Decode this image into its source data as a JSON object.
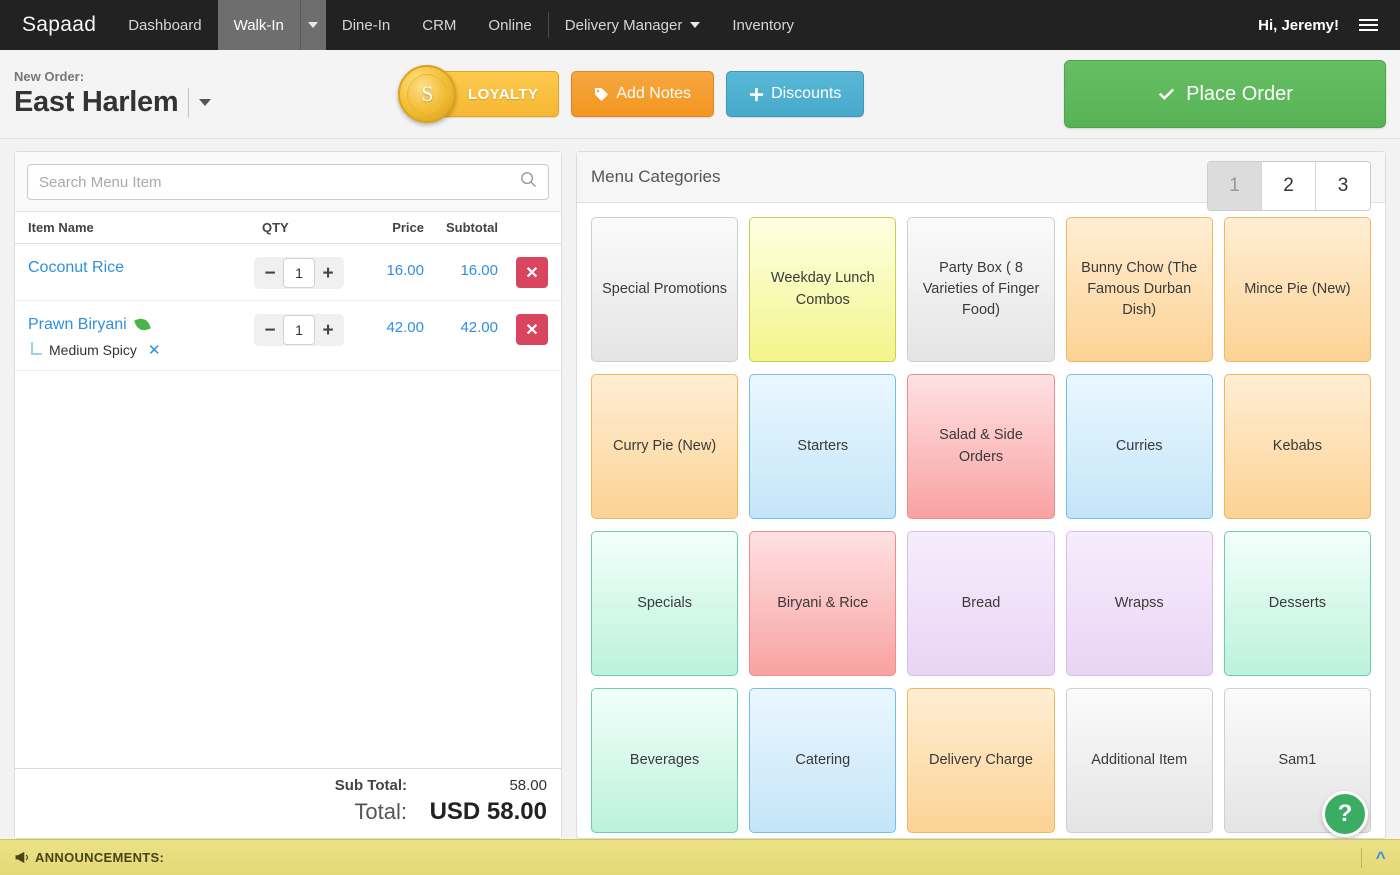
{
  "navbar": {
    "brand": "Sapaad",
    "items": [
      {
        "label": "Dashboard",
        "active": false
      },
      {
        "label": "Walk-In",
        "active": true
      },
      {
        "label": "Dine-In",
        "active": false
      },
      {
        "label": "CRM",
        "active": false
      },
      {
        "label": "Online",
        "active": false
      },
      {
        "label": "Delivery Manager",
        "active": false,
        "caret": true
      },
      {
        "label": "Inventory",
        "active": false
      }
    ],
    "greeting": "Hi, Jeremy!",
    "menu_icon": "hamburger-menu-icon"
  },
  "order_header": {
    "new_order_label": "New Order:",
    "location": "East Harlem",
    "loyalty_label": "LOYALTY",
    "loyalty_coin_letter": "S",
    "add_notes_label": "Add Notes",
    "add_notes_icon": "tag-icon",
    "discounts_label": "Discounts",
    "discounts_icon": "plus-icon",
    "place_order_label": "Place Order",
    "place_order_icon": "check-icon"
  },
  "order_panel": {
    "search_placeholder": "Search Menu Item",
    "search_value": "",
    "search_icon": "search-icon",
    "columns": {
      "name": "Item Name",
      "qty": "QTY",
      "price": "Price",
      "subtotal": "Subtotal"
    },
    "items": [
      {
        "name": "Coconut Rice",
        "vegetarian": false,
        "qty": "1",
        "price": "16.00",
        "subtotal": "16.00",
        "modifiers": []
      },
      {
        "name": "Prawn Biryani",
        "vegetarian": true,
        "qty": "1",
        "price": "42.00",
        "subtotal": "42.00",
        "modifiers": [
          {
            "label": "Medium Spicy"
          }
        ]
      }
    ],
    "totals": {
      "subtotal_label": "Sub Total:",
      "subtotal_value": "58.00",
      "total_label": "Total:",
      "total_value": "USD 58.00"
    }
  },
  "menu_panel": {
    "title": "Menu Categories",
    "pages": [
      {
        "label": "1",
        "active": true
      },
      {
        "label": "2",
        "active": false
      },
      {
        "label": "3",
        "active": false
      }
    ],
    "categories": [
      {
        "label": "Special Promotions",
        "color": "gray"
      },
      {
        "label": "Weekday Lunch Combos",
        "color": "yellow"
      },
      {
        "label": "Party Box ( 8 Varieties of Finger Food)",
        "color": "gray"
      },
      {
        "label": "Bunny Chow (The Famous Durban Dish)",
        "color": "orange"
      },
      {
        "label": "Mince Pie (New)",
        "color": "orange"
      },
      {
        "label": "Curry Pie (New)",
        "color": "orange"
      },
      {
        "label": "Starters",
        "color": "blue"
      },
      {
        "label": "Salad & Side Orders",
        "color": "red"
      },
      {
        "label": "Curries",
        "color": "blue"
      },
      {
        "label": "Kebabs",
        "color": "orange"
      },
      {
        "label": "Specials",
        "color": "mint"
      },
      {
        "label": "Biryani & Rice",
        "color": "red"
      },
      {
        "label": "Bread",
        "color": "purple"
      },
      {
        "label": "Wrapss",
        "color": "purple"
      },
      {
        "label": "Desserts",
        "color": "mint"
      },
      {
        "label": "Beverages",
        "color": "mint"
      },
      {
        "label": "Catering",
        "color": "blue"
      },
      {
        "label": "Delivery Charge",
        "color": "orange"
      },
      {
        "label": "Additional Item",
        "color": "gray"
      },
      {
        "label": "Sam1",
        "color": "gray"
      }
    ]
  },
  "footer": {
    "announcements_label": "ANNOUNCEMENTS:",
    "announcements_icon": "megaphone-icon",
    "collapse_icon": "chevron-up-icon",
    "help_label": "?"
  },
  "colors": {
    "accent_blue": "#2f8fe0",
    "place_order_green": "#57b257",
    "delete_red": "#d9455f",
    "loyalty_gold": "#f7b733",
    "notes_orange": "#f29620",
    "discounts_blue": "#47a9cb",
    "announce_yellow": "#e3d977",
    "help_green": "#3bad62"
  }
}
